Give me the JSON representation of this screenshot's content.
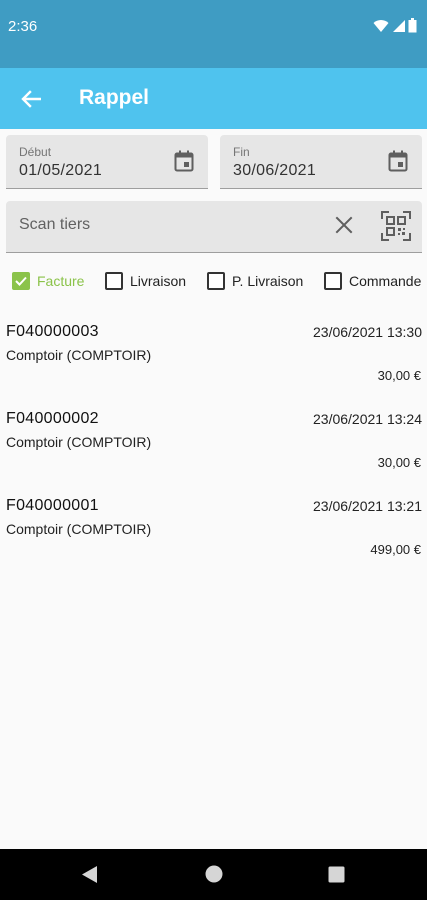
{
  "status_bar": {
    "time": "2:36"
  },
  "app_bar": {
    "title": "Rappel"
  },
  "date_range": {
    "start": {
      "label": "Début",
      "value": "01/05/2021"
    },
    "end": {
      "label": "Fin",
      "value": "30/06/2021"
    }
  },
  "scan": {
    "placeholder": "Scan tiers",
    "value": ""
  },
  "filters": [
    {
      "label": "Facture",
      "checked": true
    },
    {
      "label": "Livraison",
      "checked": false
    },
    {
      "label": "P. Livraison",
      "checked": false
    },
    {
      "label": "Commande",
      "checked": false
    }
  ],
  "items": [
    {
      "number": "F040000003",
      "datetime": "23/06/2021 13:30",
      "client": "Comptoir (COMPTOIR)",
      "amount": "30,00 €"
    },
    {
      "number": "F040000002",
      "datetime": "23/06/2021 13:24",
      "client": "Comptoir (COMPTOIR)",
      "amount": "30,00 €"
    },
    {
      "number": "F040000001",
      "datetime": "23/06/2021 13:21",
      "client": "Comptoir (COMPTOIR)",
      "amount": "499,00 €"
    }
  ],
  "colors": {
    "status_bar": "#3f9cc3",
    "app_bar": "#4fc3ee",
    "accent_checked": "#8bc34a",
    "nav_bar": "#000000"
  },
  "icons": {
    "back": "arrow-left-icon",
    "calendar": "calendar-icon",
    "clear": "close-icon",
    "scan": "qr-code-icon",
    "wifi": "wifi-icon",
    "signal": "signal-icon",
    "battery": "battery-icon"
  }
}
